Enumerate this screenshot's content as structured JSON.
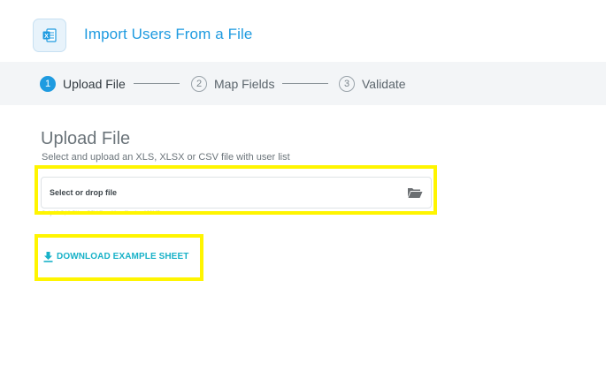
{
  "header": {
    "title": "Import Users From a File",
    "icon": "excel-file-icon"
  },
  "stepper": {
    "steps": [
      {
        "number": "1",
        "label": "Upload File",
        "active": true
      },
      {
        "number": "2",
        "label": "Map Fields",
        "active": false
      },
      {
        "number": "3",
        "label": "Validate",
        "active": false
      }
    ]
  },
  "upload": {
    "title": "Upload File",
    "description": "Select and upload an XLS, XLSX or CSV file with user list",
    "placeholder": "Select or drop file",
    "hint": "Only XLS,XLSX or CSV files. Max. file size 100MB",
    "browse_icon": "folder-open-icon"
  },
  "download": {
    "label": "DOWNLOAD EXAMPLE SHEET",
    "icon": "download-icon"
  },
  "colors": {
    "accent": "#1f9be0",
    "link": "#18b2c8",
    "highlight": "#fff500",
    "stepper_bg": "#f3f5f7"
  }
}
